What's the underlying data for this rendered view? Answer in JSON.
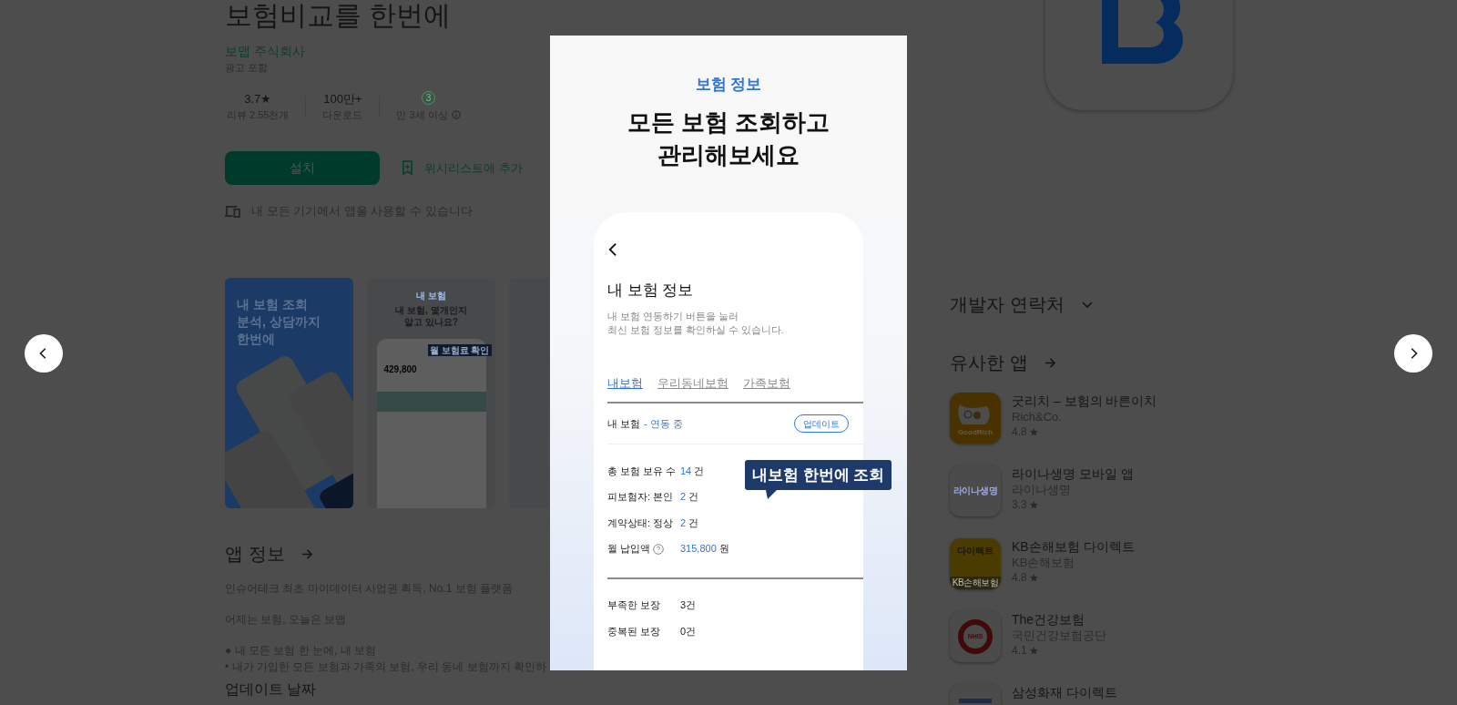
{
  "app": {
    "title": "보험비교를 한번에",
    "developer": "보맵 주식회사",
    "ads_note": "광고 포함"
  },
  "stats": [
    {
      "kind": "rating",
      "value": "3.7★",
      "label": "리뷰 2.55천개"
    },
    {
      "kind": "plain",
      "value": "100만+",
      "label": "다운로드"
    },
    {
      "kind": "age",
      "value": "3",
      "label": "만 3세 이상"
    }
  ],
  "install_button": "설치",
  "wishlist_button": "위시리스트에 추가",
  "devices_note": "내 모든 기기에서 앱을 사용할 수 있습니다",
  "screenshots": [
    {
      "kind": "promo",
      "heading_lines": [
        "내 보험 조회",
        "분석, 상담까지",
        "한번에"
      ]
    },
    {
      "kind": "phone",
      "caption": "내 보험",
      "heading_lines": [
        "내 보험, 몇개인지",
        "알고 있나요?"
      ],
      "badge": "월 보험료 확인",
      "amount": "429,800"
    },
    {
      "kind": "partial"
    }
  ],
  "about": {
    "title": "앱 정보",
    "paragraphs": [
      "인슈어테크 최초 마이데이터 사업권 획득, No.1 보험 플랫폼",
      "어제는 보험, 오늘은 보맵"
    ],
    "bullets": [
      "● 내 모든 보험 한 눈에, 내 보험",
      "• 내가 가입한 모든 보험과 가족의 보험, 우리 동네 보험까지 확인하"
    ],
    "next_heading": "업데이트 날짜"
  },
  "developer_contact": {
    "title": "개발자 연락처",
    "expanded": false
  },
  "similar_apps": {
    "title": "유사한 앱",
    "items": [
      {
        "name": "굿리치 – 보험의 바른이치",
        "developer": "Rich&Co.",
        "rating": "4.8",
        "icon": {
          "kind": "goodrich",
          "text": "GoodRich",
          "color": "#4a3100"
        }
      },
      {
        "name": "라이나생명 모바일 앱",
        "developer": "라이나생명",
        "rating": "3.3",
        "icon": {
          "kind": "lina",
          "text": "라이나생명",
          "color": "#4b4b4b"
        }
      },
      {
        "name": "KB손해보험 다이렉트",
        "developer": "KB손해보험",
        "rating": "4.8",
        "icon": {
          "kind": "kb",
          "text": "다이렉트",
          "subtext": "KB손해보험",
          "color": "#4a3c00"
        }
      },
      {
        "name": "The건강보험",
        "developer": "국민건강보험공단",
        "rating": "4.1",
        "icon": {
          "kind": "nhis",
          "text": "NHIS",
          "color": "#4b4b4b"
        }
      },
      {
        "name": "삼성화재 다이렉트",
        "icon": {
          "kind": "samsung",
          "color": "#4b4b4b"
        }
      }
    ]
  },
  "lightbox": {
    "eyebrow": "보험 정보",
    "headline_lines": [
      "모든 보험 조회하고",
      "관리해보세요"
    ],
    "screen": {
      "title": "내 보험 정보",
      "description_lines": [
        "내 보험 연동하기 버튼을 눌러",
        "최신 보험 정보를 확인하실 수 있습니다."
      ],
      "tabs": [
        {
          "label": "내보험",
          "selected": true
        },
        {
          "label": "우리동네보험",
          "selected": false
        },
        {
          "label": "가족보험",
          "selected": false
        }
      ],
      "status_label": "내 보험",
      "status_value": "- 연동 중",
      "update_button": "업데이트",
      "summary_rows": [
        {
          "label": "총 보험 보유 수",
          "value": "14",
          "unit": "건",
          "help": false
        },
        {
          "label": "피보험자: 본인",
          "value": "2",
          "unit": "건",
          "help": false
        },
        {
          "label": "계약상태: 정상",
          "value": "2",
          "unit": "건",
          "help": false
        },
        {
          "label": "월 납입액",
          "value": "315,800",
          "unit": "원",
          "help": true
        }
      ],
      "coverage_rows": [
        {
          "label": "부족한 보장",
          "value": "3건"
        },
        {
          "label": "중복된 보장",
          "value": "0건"
        }
      ]
    },
    "callout": "내보험 한번에 조회"
  }
}
